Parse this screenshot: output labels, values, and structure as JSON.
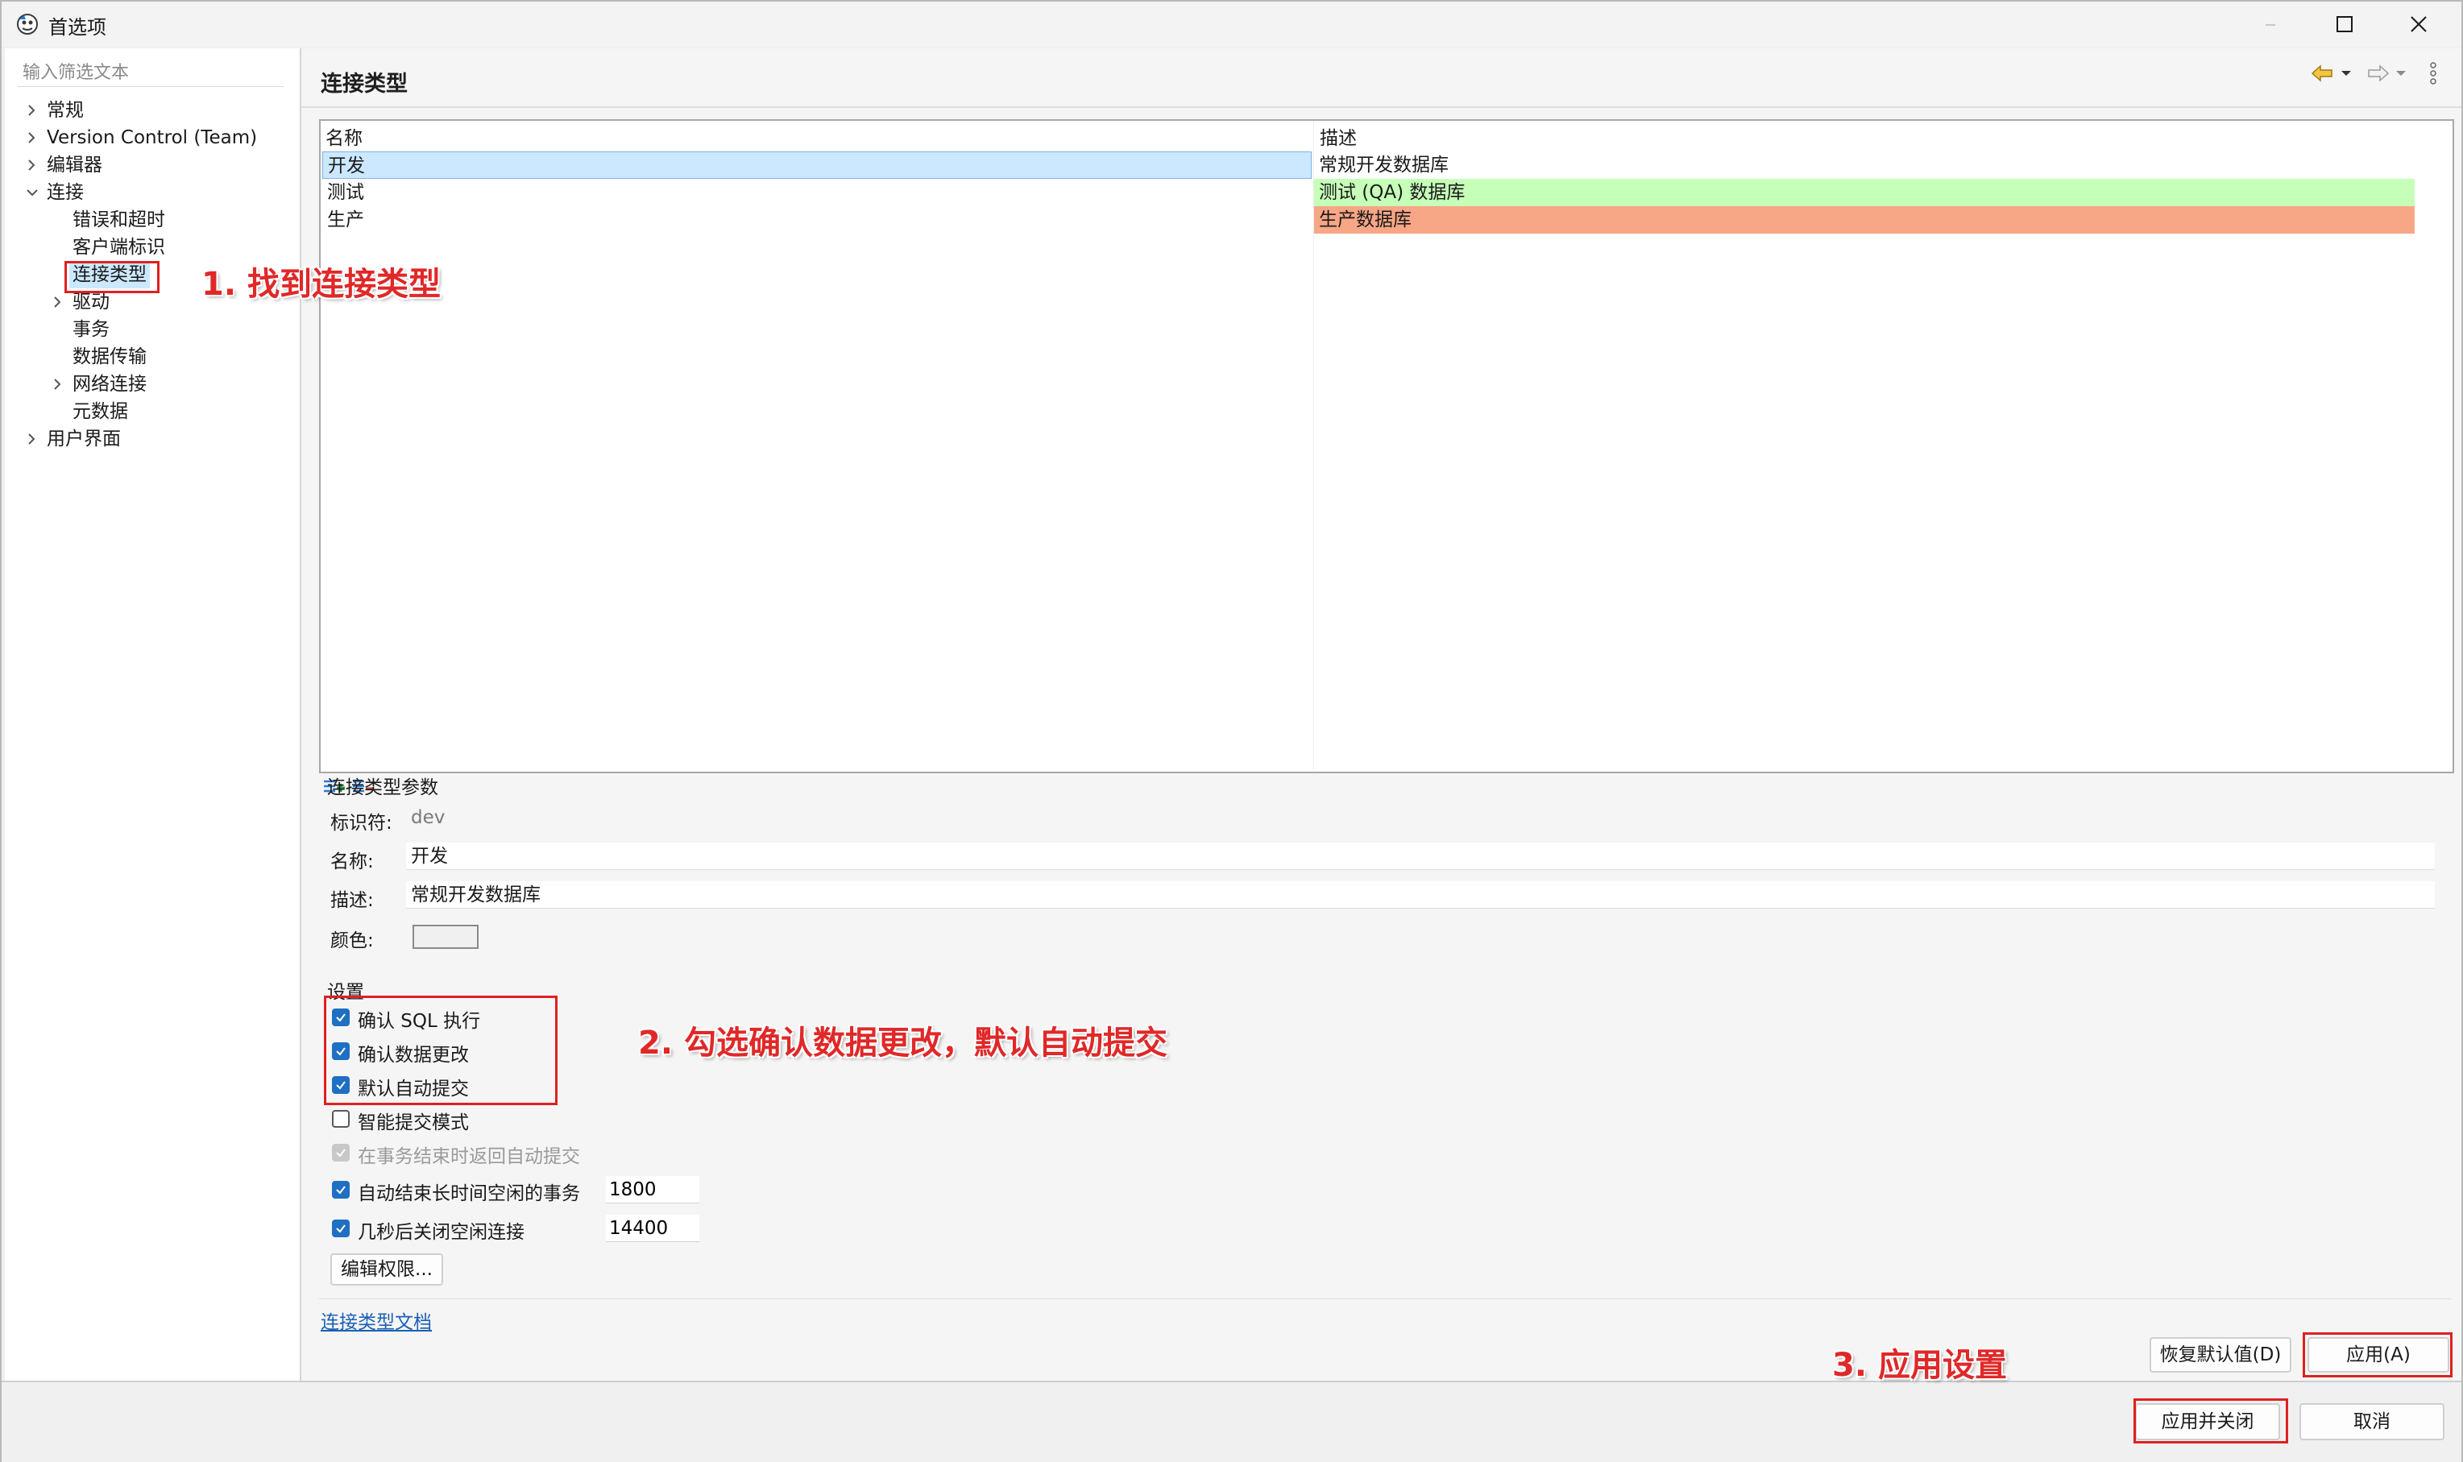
{
  "window": {
    "title": "首选项",
    "controls": [
      "minimize-icon",
      "maximize-icon",
      "close-icon"
    ]
  },
  "sidebar": {
    "filter_placeholder": "输入筛选文本",
    "items": [
      {
        "label": "常规",
        "level": 0,
        "chevron": "right"
      },
      {
        "label": "Version Control (Team)",
        "level": 0,
        "chevron": "right"
      },
      {
        "label": "编辑器",
        "level": 0,
        "chevron": "right"
      },
      {
        "label": "连接",
        "level": 0,
        "chevron": "down"
      },
      {
        "label": "错误和超时",
        "level": 1,
        "chevron": "none"
      },
      {
        "label": "客户端标识",
        "level": 1,
        "chevron": "none"
      },
      {
        "label": "连接类型",
        "level": 1,
        "chevron": "none",
        "selected": true
      },
      {
        "label": "驱动",
        "level": 1,
        "chevron": "right"
      },
      {
        "label": "事务",
        "level": 1,
        "chevron": "none"
      },
      {
        "label": "数据传输",
        "level": 1,
        "chevron": "none"
      },
      {
        "label": "网络连接",
        "level": 1,
        "chevron": "right"
      },
      {
        "label": "元数据",
        "level": 1,
        "chevron": "none"
      },
      {
        "label": "用户界面",
        "level": 0,
        "chevron": "right"
      }
    ]
  },
  "page": {
    "title": "连接类型",
    "nav_icons": [
      "back-arrow-icon",
      "forward-arrow-icon",
      "more-icon"
    ]
  },
  "types_table": {
    "columns": [
      "名称",
      "描述"
    ],
    "rows": [
      {
        "name": "开发",
        "description": "常规开发数据库",
        "color": "#ffffff",
        "selected": true
      },
      {
        "name": "测试",
        "description": "测试 (QA) 数据库",
        "color": "#c6ffb8"
      },
      {
        "name": "生产",
        "description": "生产数据库",
        "color": "#f7a686"
      }
    ]
  },
  "params": {
    "group_label": "连接类型参数",
    "id_label": "标识符:",
    "id_value": "dev",
    "name_label": "名称:",
    "name_value": "开发",
    "desc_label": "描述:",
    "desc_value": "常规开发数据库",
    "color_label": "颜色:"
  },
  "settings": {
    "group_label": "设置",
    "checkboxes": [
      {
        "label": "确认 SQL 执行",
        "checked": true
      },
      {
        "label": "确认数据更改",
        "checked": true
      },
      {
        "label": "默认自动提交",
        "checked": true
      },
      {
        "label": "智能提交模式",
        "checked": false
      },
      {
        "label": "在事务结束时返回自动提交",
        "checked": true,
        "disabled": true
      },
      {
        "label": "自动结束长时间空闲的事务",
        "checked": true,
        "value": "1800"
      },
      {
        "label": "几秒后关闭空闲连接",
        "checked": true,
        "value": "14400"
      }
    ],
    "edit_permissions": "编辑权限..."
  },
  "doc_link": "连接类型文档",
  "buttons": {
    "restore_defaults": "恢复默认值(D)",
    "apply": "应用(A)",
    "apply_close": "应用并关闭",
    "cancel": "取消"
  },
  "annotations": {
    "step1": "1. 找到连接类型",
    "step2": "2. 勾选确认数据更改，默认自动提交",
    "step3": "3. 应用设置"
  },
  "colors": {
    "selection": "#cce8ff",
    "test_row": "#c6ffb8",
    "prod_row": "#f7a686",
    "checkbox": "#1f6fc2",
    "annotation": "#e02828"
  }
}
